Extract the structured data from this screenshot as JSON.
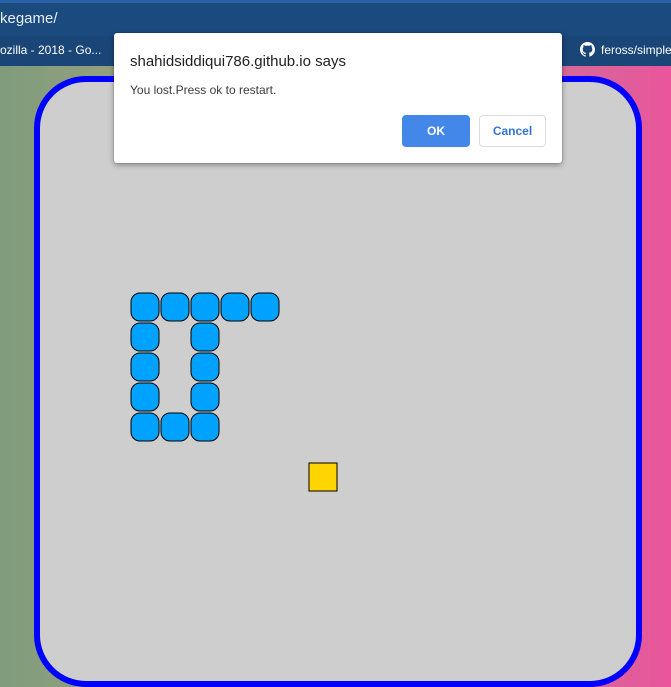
{
  "browser": {
    "address_text": "kegame/",
    "bookmarks": {
      "left_label": "ozilla - 2018 - Go...",
      "right_label": "feross/simple",
      "right_icon": "github-icon"
    }
  },
  "dialog": {
    "title": "shahidsiddiqui786.github.io says",
    "message": "You lost.Press ok to restart.",
    "ok_label": "OK",
    "cancel_label": "Cancel"
  },
  "game": {
    "colors": {
      "board_background": "#cecece",
      "board_border": "#0000ff",
      "snake": "#00a2ff",
      "food": "#ffd400"
    },
    "grid_unit": "cell",
    "snake_segments": [
      {
        "col": 0,
        "row": 0
      },
      {
        "col": 1,
        "row": 0
      },
      {
        "col": 2,
        "row": 0
      },
      {
        "col": 3,
        "row": 0
      },
      {
        "col": 4,
        "row": 0
      },
      {
        "col": 0,
        "row": 1
      },
      {
        "col": 2,
        "row": 1
      },
      {
        "col": 0,
        "row": 2
      },
      {
        "col": 2,
        "row": 2
      },
      {
        "col": 0,
        "row": 3
      },
      {
        "col": 2,
        "row": 3
      },
      {
        "col": 0,
        "row": 4
      },
      {
        "col": 1,
        "row": 4
      },
      {
        "col": 2,
        "row": 4
      }
    ],
    "food": {
      "col": 6,
      "row": 6
    }
  }
}
